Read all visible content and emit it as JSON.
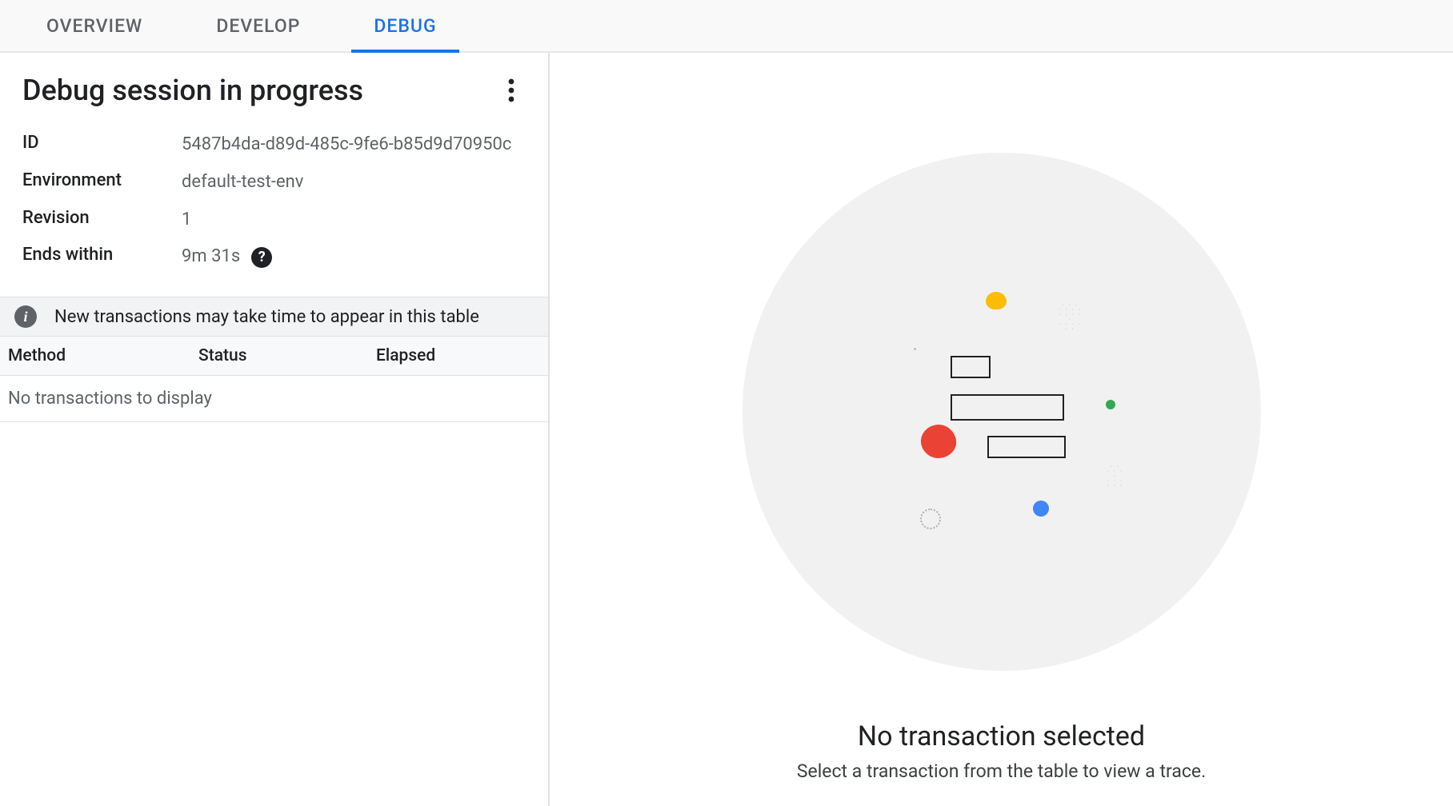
{
  "tabs": {
    "overview": "OVERVIEW",
    "develop": "DEVELOP",
    "debug": "DEBUG",
    "active": "debug"
  },
  "session": {
    "title": "Debug session in progress",
    "fields": {
      "id_label": "ID",
      "id_value": "5487b4da-d89d-485c-9fe6-b85d9d70950c",
      "env_label": "Environment",
      "env_value": "default-test-env",
      "rev_label": "Revision",
      "rev_value": "1",
      "ends_label": "Ends within",
      "ends_value": "9m 31s"
    }
  },
  "banner": {
    "text": "New transactions may take time to appear in this table"
  },
  "table": {
    "headers": {
      "method": "Method",
      "status": "Status",
      "elapsed": "Elapsed"
    },
    "empty": "No transactions to display"
  },
  "empty_state": {
    "title": "No transaction selected",
    "subtitle": "Select a transaction from the table to view a trace."
  }
}
